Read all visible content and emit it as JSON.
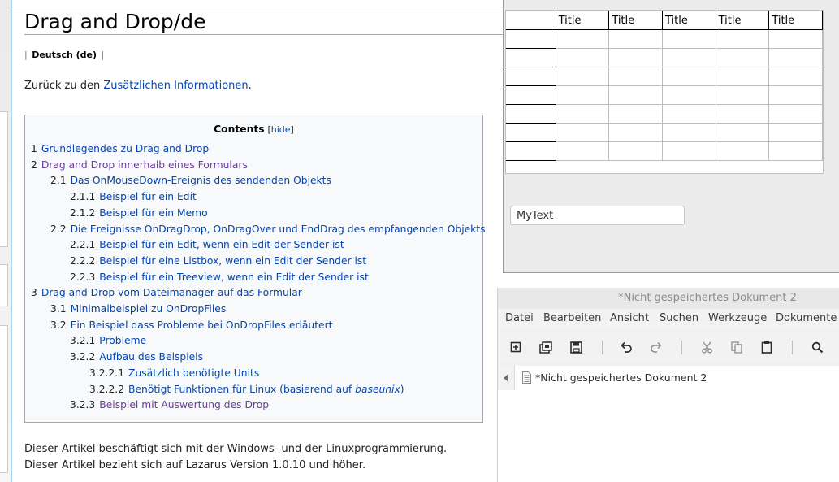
{
  "wiki": {
    "title": "Drag and Drop/de",
    "lang": {
      "label": "Deutsch (de)",
      "sep": "|"
    },
    "back": {
      "prefix": "Zurück zu den ",
      "link": "Zusätzlichen Informationen",
      "suffix": "."
    },
    "toc": {
      "title": "Contents",
      "hide": "hide",
      "items": [
        {
          "num": "1",
          "text": "Grundlegendes zu Drag and Drop",
          "level": 0,
          "visited": false
        },
        {
          "num": "2",
          "text": "Drag and Drop innerhalb eines Formulars",
          "level": 0,
          "visited": true
        },
        {
          "num": "2.1",
          "text": "Das OnMouseDown-Ereignis des sendenden Objekts",
          "level": 1,
          "visited": false
        },
        {
          "num": "2.1.1",
          "text": "Beispiel für ein Edit",
          "level": 2,
          "visited": false
        },
        {
          "num": "2.1.2",
          "text": "Beispiel für ein Memo",
          "level": 2,
          "visited": false
        },
        {
          "num": "2.2",
          "text": "Die Ereignisse OnDragDrop, OnDragOver und EndDrag des empfangenden Objekts",
          "level": 1,
          "visited": false
        },
        {
          "num": "2.2.1",
          "text": "Beispiel für ein Edit, wenn ein Edit der Sender ist",
          "level": 2,
          "visited": false
        },
        {
          "num": "2.2.2",
          "text": "Beispiel für eine Listbox, wenn ein Edit der Sender ist",
          "level": 2,
          "visited": false
        },
        {
          "num": "2.2.3",
          "text": "Beispiel für ein Treeview, wenn ein Edit der Sender ist",
          "level": 2,
          "visited": false
        },
        {
          "num": "3",
          "text": "Drag and Drop vom Dateimanager auf das Formular",
          "level": 0,
          "visited": false
        },
        {
          "num": "3.1",
          "text": "Minimalbeispiel zu OnDropFiles",
          "level": 1,
          "visited": false
        },
        {
          "num": "3.2",
          "text": "Ein Beispiel dass Probleme bei OnDropFiles erläutert",
          "level": 1,
          "visited": false
        },
        {
          "num": "3.2.1",
          "text": "Probleme",
          "level": 2,
          "visited": false
        },
        {
          "num": "3.2.2",
          "text": "Aufbau des Beispiels",
          "level": 2,
          "visited": false
        },
        {
          "num": "3.2.2.1",
          "text": "Zusätzlich benötigte Units",
          "level": 3,
          "visited": false
        },
        {
          "num": "3.2.2.2",
          "text": "Benötigt Funktionen für Linux (basierend auf ",
          "italic": "baseunix",
          "after": ")",
          "level": 3,
          "visited": false
        },
        {
          "num": "3.2.3",
          "text": "Beispiel mit Auswertung des Drop",
          "level": 2,
          "visited": true
        }
      ]
    },
    "desc1": "Dieser Artikel beschäftigt sich mit der Windows- und der Linuxprogrammierung.",
    "desc2": "Dieser Artikel bezieht sich auf Lazarus Version 1.0.10 und höher."
  },
  "form": {
    "grid": {
      "headers": [
        "Title",
        "Title",
        "Title",
        "Title",
        "Title"
      ],
      "rows": 7
    },
    "edit": {
      "value": "MyText"
    }
  },
  "editor": {
    "title": "*Nicht gespeichertes Dokument 2",
    "menu": [
      "Datei",
      "Bearbeiten",
      "Ansicht",
      "Suchen",
      "Werkzeuge",
      "Dokumente"
    ],
    "toolbar_icons": [
      "new-document-icon",
      "open-icon",
      "save-icon",
      "undo-icon",
      "redo-icon",
      "cut-icon",
      "copy-icon",
      "paste-icon",
      "search-icon"
    ],
    "document": "*Nicht gespeichertes Dokument 2"
  },
  "colors": {
    "link": "#0645ad",
    "visited": "#6a3d96",
    "toc_bg": "#f8f9fa"
  }
}
